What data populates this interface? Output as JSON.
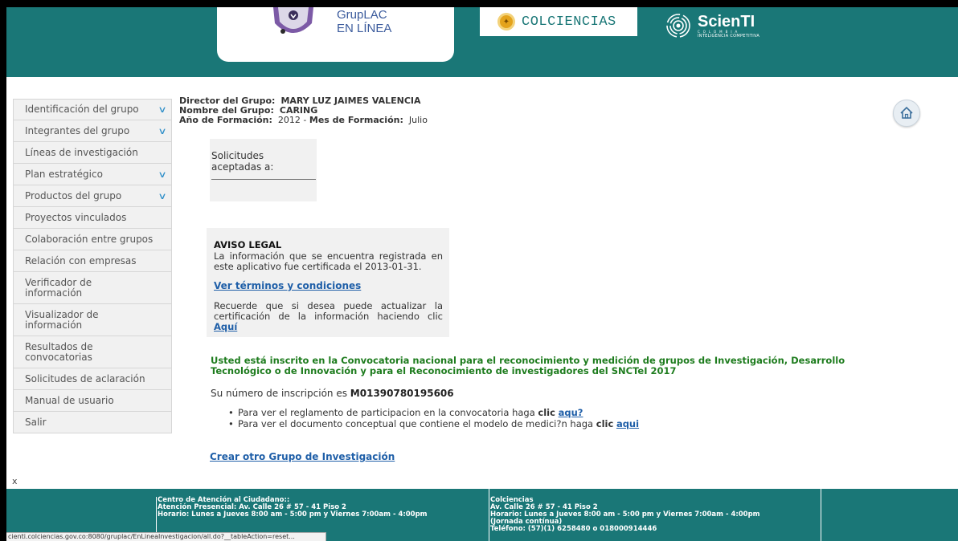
{
  "header": {
    "gruplac_line1": "GrupLAC",
    "gruplac_line2": "EN LÍNEA",
    "colciencias": "COLCIENCIAS",
    "scienti_name": "ScienTI",
    "scienti_country": "COLOMBIA",
    "scienti_tagline": "INTELIGENCIA COMPETITIVA"
  },
  "sidebar": {
    "items": [
      {
        "label": "Identificación del grupo",
        "dropdown": true
      },
      {
        "label": "Integrantes del grupo",
        "dropdown": true
      },
      {
        "label": "Líneas de investigación",
        "dropdown": false
      },
      {
        "label": "Plan estratégico",
        "dropdown": true
      },
      {
        "label": "Productos del grupo",
        "dropdown": true
      },
      {
        "label": "Proyectos vinculados",
        "dropdown": false
      },
      {
        "label": "Colaboración entre grupos",
        "dropdown": false
      },
      {
        "label": "Relación con empresas",
        "dropdown": false
      },
      {
        "label": "Verificador de información",
        "dropdown": false
      },
      {
        "label": "Visualizador de información",
        "dropdown": false
      },
      {
        "label": "Resultados de convocatorias",
        "dropdown": false
      },
      {
        "label": "Solicitudes de aclaración",
        "dropdown": false
      },
      {
        "label": "Manual de usuario",
        "dropdown": false
      },
      {
        "label": "Salir",
        "dropdown": false
      }
    ]
  },
  "group": {
    "director_label": "Director del Grupo:",
    "director_value": "MARY LUZ JAIMES VALENCIA",
    "name_label": "Nombre del Grupo:",
    "name_value": "CARING",
    "year_label": "Año de Formación:",
    "year_value": "2012",
    "month_label": "Mes de Formación:",
    "month_value": "Julio"
  },
  "solicitudes": {
    "label": "Solicitudes aceptadas a:"
  },
  "aviso": {
    "title": "AVISO LEGAL",
    "text": "La información que se encuentra registrada en este aplicativo fue certificada el 2013-01-31.",
    "terms_link": "Ver términos y condiciones",
    "update_text": "Recuerde que si desea puede actualizar la certificación de la información haciendo clic",
    "update_link": "Aquí"
  },
  "convocatoria": {
    "text": "Usted está inscrito en la Convocatoria nacional para el reconocimiento y medición de grupos de Investigación, Desarrollo Tecnológico o de Innovación y para el Reconocimiento de investigadores del SNCTeI 2017",
    "inscripcion_label": "Su número de inscripción es",
    "inscripcion_number": "M01390780195606",
    "bullet1_text": "Para ver el reglamento de participacion en la convocatoria haga",
    "bullet1_clic": "clic",
    "bullet1_link": "aqu?",
    "bullet2_text": "Para ver el documento conceptual que contiene el modelo de medici?n haga",
    "bullet2_clic": "clic",
    "bullet2_link": "aqui"
  },
  "crear_link": "Crear otro Grupo de Investigación",
  "x_mark": "x",
  "footer": {
    "col1_title": "Centro de Atención al Ciudadano::",
    "col1_line1": "Atención Presencial: Av. Calle 26 # 57 - 41 Piso 2",
    "col1_line2": "Horario: Lunes a Jueves 8:00 am - 5:00 pm y Viernes 7:00am - 4:00pm",
    "col2_title": "Colciencias",
    "col2_line1": "Av. Calle 26 # 57 - 41 Piso 2",
    "col2_line2": "Horario: Lunes a Jueves 8:00 am - 5:00 pm y Viernes 7:00am - 4:00pm",
    "col2_line3": "(Jornada contínua)",
    "col2_line4": "Teléfono: (57)(1) 6258480 o 018000914446"
  },
  "status_url": "cienti.colciencias.gov.co:8080/gruplac/EnLineaInvestigacion/all.do?__tableAction=reset...",
  "icons": {
    "chevron": "chevron-down-icon",
    "home": "home-icon"
  },
  "colors": {
    "header_teal": "#1a7777",
    "link_blue": "#1f5fa8",
    "green_text": "#1e7c1e",
    "sidebar_bg": "#f1f1f1"
  }
}
